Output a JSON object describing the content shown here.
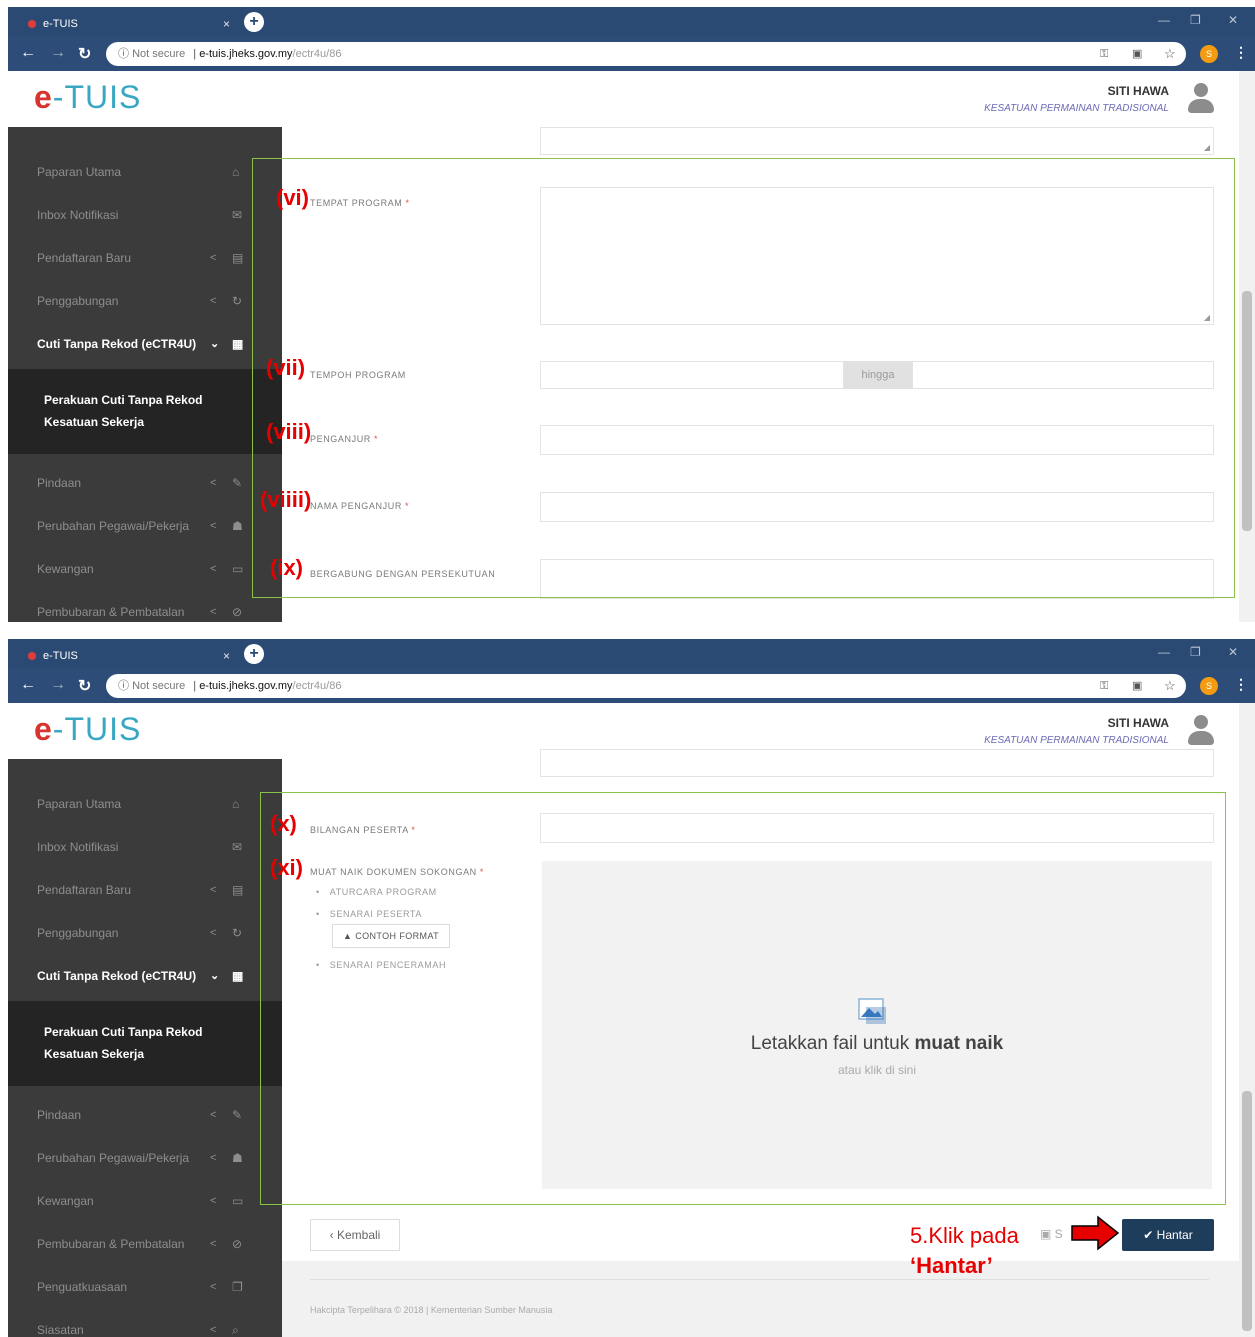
{
  "browser": {
    "tab_title": "e-TUIS",
    "tab_close": "×",
    "new_tab": "+",
    "security": "Not secure",
    "url_host": "e-tuis.jheks.gov.my",
    "url_path": "/ectr4u/86",
    "profile_initial": "S"
  },
  "header": {
    "logo_e": "e",
    "logo_text": "-TUIS",
    "user_name": "SITI HAWA",
    "user_org": "KESATUAN PERMAINAN TRADISIONAL"
  },
  "sidebar": {
    "items": [
      {
        "label": "Paparan Utama",
        "icon": "home-icon",
        "glyph": "⌂"
      },
      {
        "label": "Inbox Notifikasi",
        "icon": "inbox-icon",
        "glyph": "✉"
      },
      {
        "label": "Pendaftaran Baru",
        "icon": "file-icon",
        "glyph": "▤"
      },
      {
        "label": "Penggabungan",
        "icon": "refresh-icon",
        "glyph": "↻"
      },
      {
        "label": "Cuti Tanpa Rekod (eCTR4U)",
        "icon": "calendar-icon",
        "glyph": "▦"
      },
      {
        "label": "Pindaan",
        "icon": "edit-icon",
        "glyph": "✎"
      },
      {
        "label": "Perubahan Pegawai/Pekerja",
        "icon": "users-icon",
        "glyph": "☗"
      },
      {
        "label": "Kewangan",
        "icon": "money-icon",
        "glyph": "▭"
      },
      {
        "label": "Pembubaran & Pembatalan",
        "icon": "cancel-icon",
        "glyph": "⊘"
      },
      {
        "label": "Penguatkuasaan",
        "icon": "copy-icon",
        "glyph": "❐"
      },
      {
        "label": "Siasatan",
        "icon": "search-icon",
        "glyph": "⌕"
      }
    ],
    "submenu_line1": "Perakuan Cuti Tanpa Rekod",
    "submenu_line2": "Kesatuan Sekerja",
    "chevron": "<",
    "chevron_open": "⌄"
  },
  "form1": {
    "markers": {
      "vi": "(vi)",
      "vii": "(vii)",
      "viii_a": "(viii)",
      "viii_b": "(viiii)",
      "ix": "(ix)"
    },
    "labels": {
      "tempat": "TEMPAT PROGRAM",
      "tempoh": "TEMPOH PROGRAM",
      "penganjur": "PENGANJUR",
      "nama_penganjur": "NAMA PENGANJUR",
      "bergabung": "BERGABUNG DENGAN PERSEKUTUAN"
    },
    "hingga": "hingga",
    "required_mark": "*"
  },
  "form2": {
    "markers": {
      "x": "(x)",
      "xi": "(xi)"
    },
    "labels": {
      "bilangan": "BILANGAN PESERTA",
      "muat_naik": "MUAT NAIK DOKUMEN SOKONGAN"
    },
    "documents": [
      "ATURCARA PROGRAM",
      "SENARAI PESERTA",
      "SENARAI PENCERAMAH"
    ],
    "format_button": "CONTOH FORMAT",
    "dropzone_main_prefix": "Letakkan fail untuk ",
    "dropzone_main_bold": "muat naik",
    "dropzone_sub": "atau klik di sini",
    "back_button": "Kembali",
    "save_button": "S",
    "submit_button": "Hantar",
    "copyright": "Hakcipta Terpelihara © 2018 | Kementerian Sumber Manusia"
  },
  "annotation": {
    "line1": "5.Klik pada",
    "line2": "‘Hantar’"
  }
}
